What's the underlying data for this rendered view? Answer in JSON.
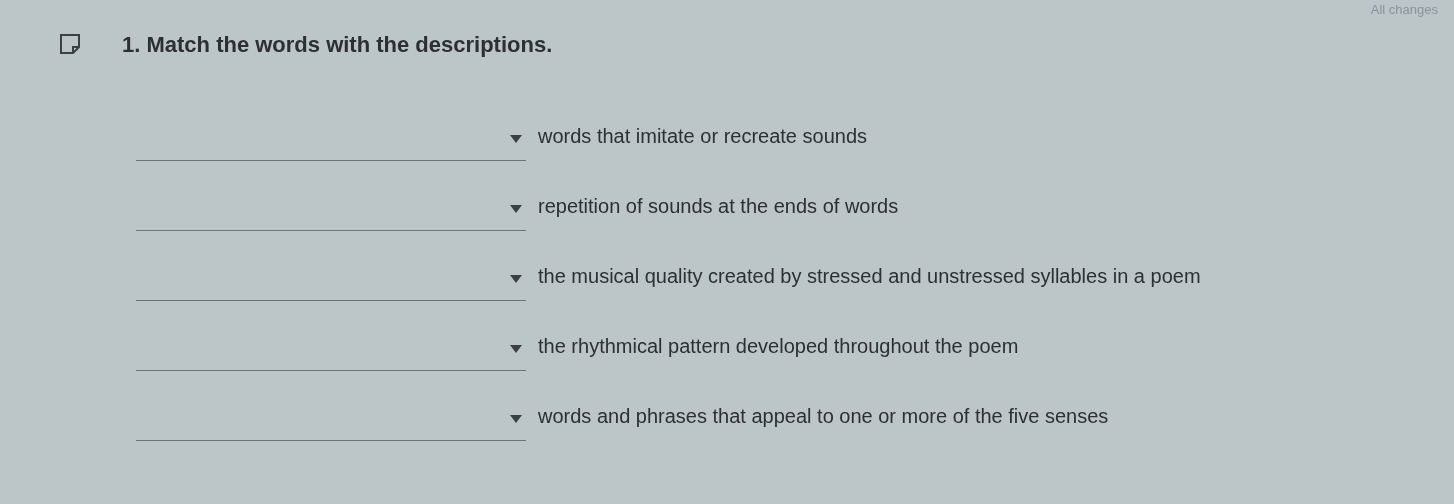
{
  "status": "All changes",
  "question": {
    "title": "1. Match the words with the descriptions."
  },
  "items": [
    {
      "description": "words that imitate or recreate sounds"
    },
    {
      "description": "repetition of sounds at the ends of words"
    },
    {
      "description": "the musical quality created by stressed and unstressed syllables in a poem"
    },
    {
      "description": "the rhythmical pattern developed throughout the poem"
    },
    {
      "description": "words and phrases that appeal to one or more of the five senses"
    }
  ]
}
